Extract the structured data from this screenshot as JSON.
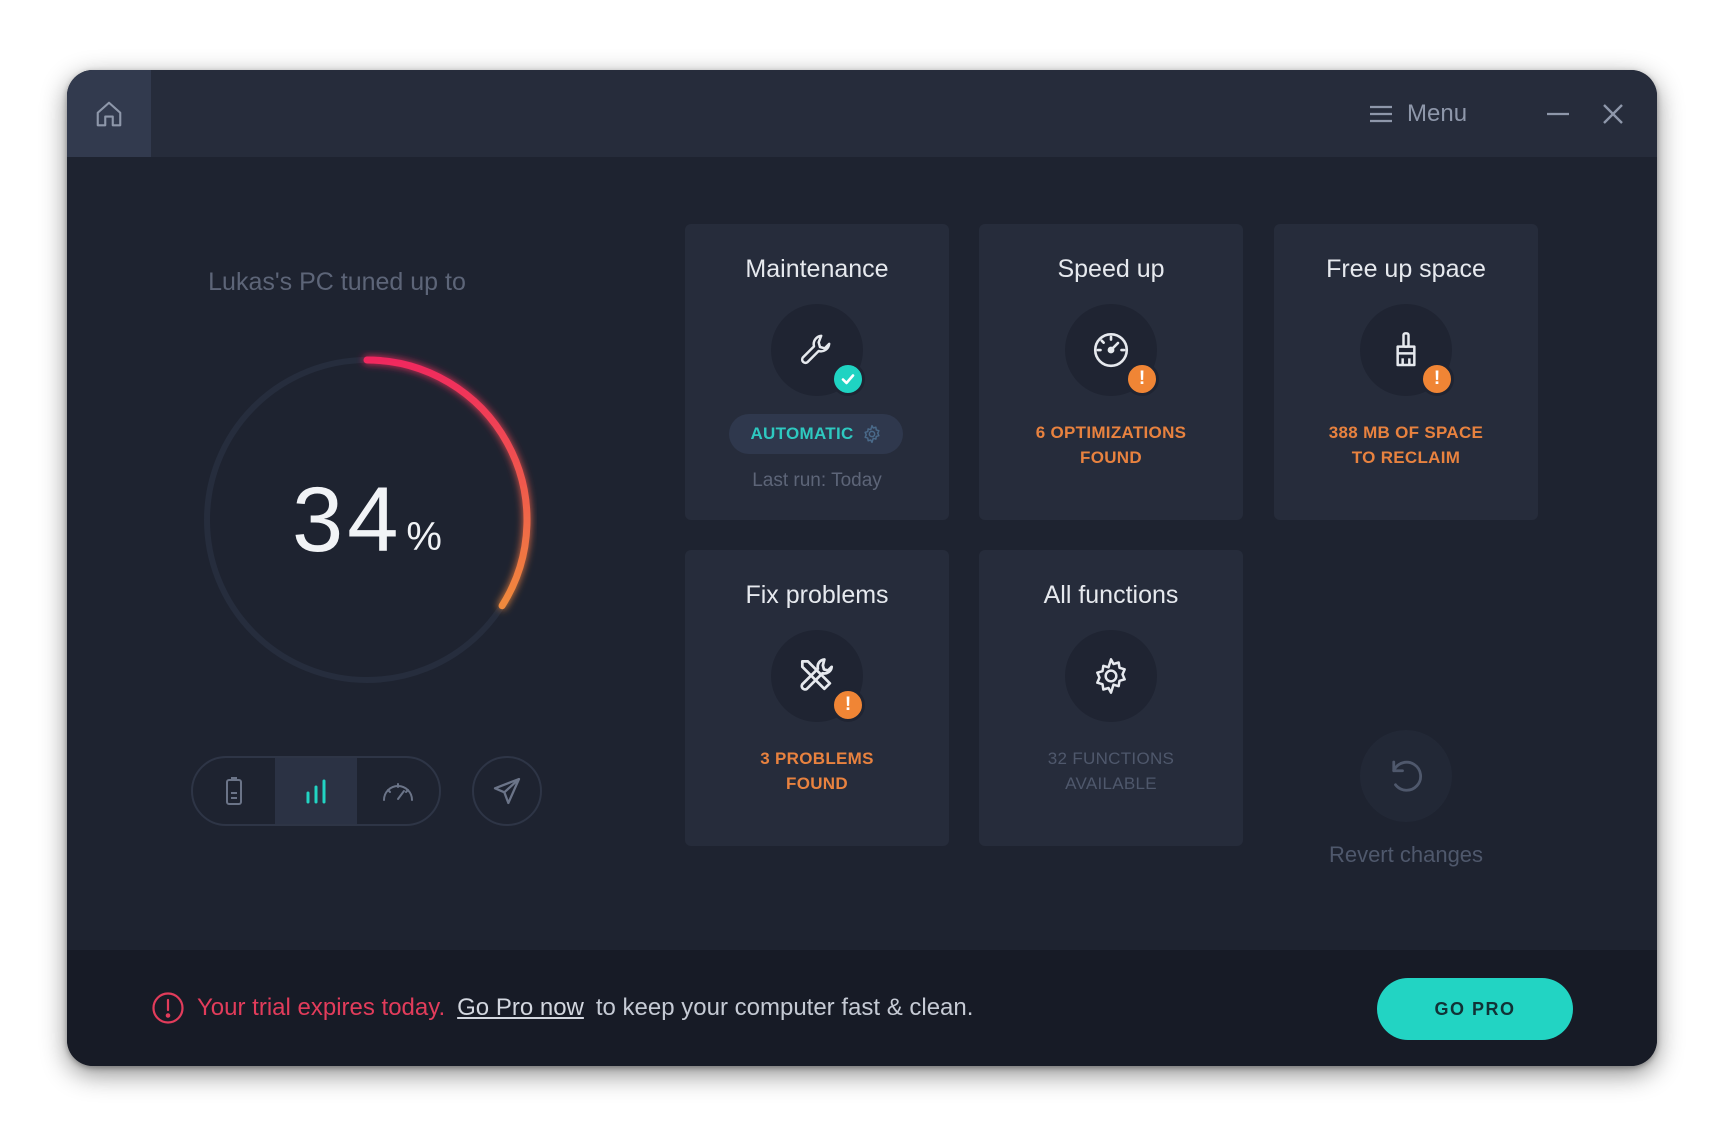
{
  "titlebar": {
    "menu_label": "Menu",
    "icons": [
      "home-icon",
      "hamburger-icon",
      "minimize-icon",
      "close-icon"
    ]
  },
  "dashboard": {
    "headline": "Lukas's PC tuned up to",
    "gauge": {
      "value": 34,
      "display": "34",
      "unit": "%",
      "fraction": 0.34
    },
    "mode_buttons": [
      {
        "icon": "battery-icon",
        "active": false
      },
      {
        "icon": "bar-chart-icon",
        "active": true
      },
      {
        "icon": "speedometer-icon",
        "active": false
      }
    ],
    "airplane_icon": "airplane-icon"
  },
  "cards": {
    "maintenance": {
      "title": "Maintenance",
      "pill_label": "AUTOMATIC",
      "last_run": "Last run: Today",
      "icon": "wrench-icon"
    },
    "speed_up": {
      "title": "Speed up",
      "status_line1": "6 OPTIMIZATIONS",
      "status_line2": "FOUND",
      "icon": "speedometer-icon"
    },
    "free_space": {
      "title": "Free up space",
      "status_line1": "388 MB OF SPACE",
      "status_line2": "TO RECLAIM",
      "icon": "broom-icon"
    },
    "fix_problems": {
      "title": "Fix problems",
      "status_line1": "3 PROBLEMS",
      "status_line2": "FOUND",
      "icon": "tools-icon"
    },
    "all_functions": {
      "title": "All functions",
      "status_line1": "32 FUNCTIONS",
      "status_line2": "AVAILABLE",
      "icon": "gear-icon"
    },
    "revert": {
      "label": "Revert changes",
      "icon": "undo-icon"
    }
  },
  "footer": {
    "alert_text": "Your trial expires today.",
    "link_text": "Go Pro now",
    "rest_text": "to keep your computer fast & clean.",
    "button_label": "GO PRO"
  },
  "colors": {
    "background": "#1e2330",
    "card": "#262c3b",
    "accent_teal": "#22d4c3",
    "warning_orange": "#f08535",
    "alert_red": "#e23c5b",
    "gauge_start": "#f0285e",
    "gauge_end": "#f08a3c"
  }
}
